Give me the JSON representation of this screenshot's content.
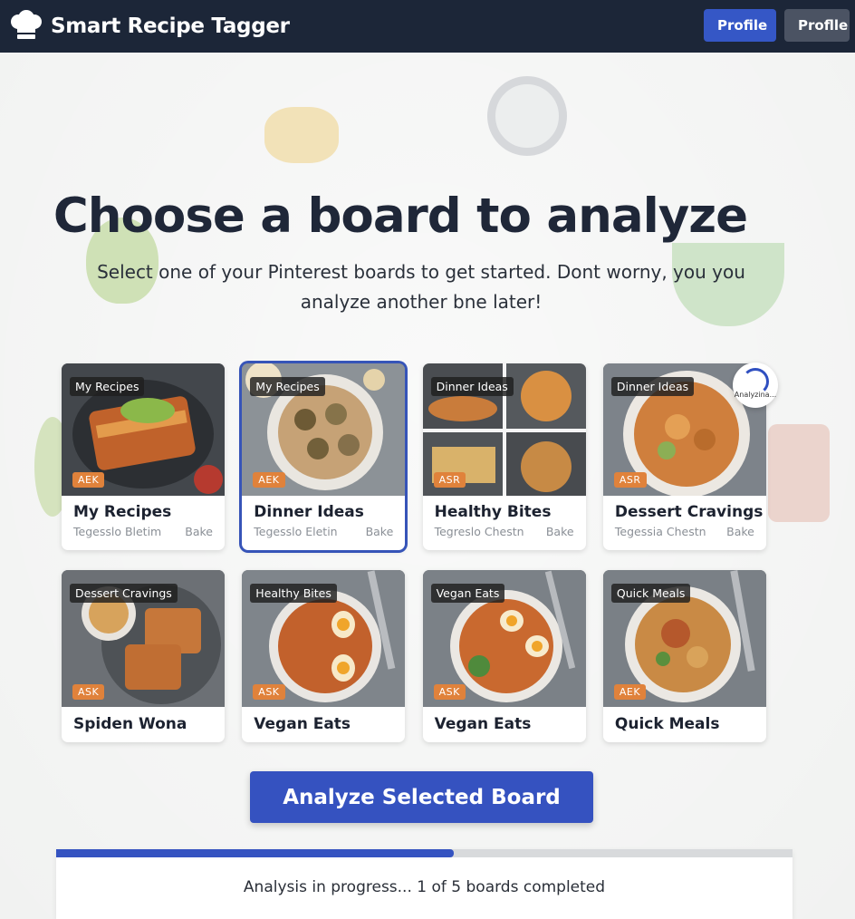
{
  "app": {
    "title": "Smart Recipe Tagger",
    "profile_button_primary": "Profile",
    "profile_button_secondary": "Proflle"
  },
  "page": {
    "headline": "Choose a board to analyze",
    "subline": "Select one of your Pinterest boards to get started. Dont worny, you you analyze another bne later!"
  },
  "boards": [
    {
      "tag": "My Recipes",
      "badge": "AEK",
      "title": "My Recipes",
      "meta": "Tegesslo Bletim",
      "category": "Bake",
      "selected": false
    },
    {
      "tag": "My Recipes",
      "badge": "AEK",
      "title": "Dinner Ideas",
      "meta": "Tegesslo Eletin",
      "category": "Bake",
      "selected": true
    },
    {
      "tag": "Dinner Ideas",
      "badge": "ASR",
      "title": "Healthy Bites",
      "meta": "Tegreslo Chestn",
      "category": "Bake",
      "selected": false
    },
    {
      "tag": "Dinner Ideas",
      "badge": "ASR",
      "title": "Dessert Cravings",
      "meta": "Tegessia Chestn",
      "category": "Bake",
      "selected": false
    },
    {
      "tag": "Dessert Cravings",
      "badge": "ASK",
      "title": "Spiden Wona",
      "meta": "",
      "category": "",
      "selected": false
    },
    {
      "tag": "Healthy Bites",
      "badge": "ASK",
      "title": "Vegan Eats",
      "meta": "",
      "category": "",
      "selected": false
    },
    {
      "tag": "Vegan Eats",
      "badge": "ASK",
      "title": "Vegan Eats",
      "meta": "",
      "category": "",
      "selected": false
    },
    {
      "tag": "Quick Meals",
      "badge": "AEK",
      "title": "Quick Meals",
      "meta": "",
      "category": "",
      "selected": false
    }
  ],
  "analyzing": {
    "label": "Analyzina..."
  },
  "actions": {
    "analyze_label": "Analyze Selected Board"
  },
  "progress": {
    "text": "Analysis in progress... 1 of 5 boards completed",
    "completed": 1,
    "total": 5,
    "fill_fraction": 0.54
  },
  "colors": {
    "header_bg": "#1c2638",
    "accent": "#3552c0",
    "badge": "#e0823b"
  },
  "icons": {
    "logo": "chef-hat-icon"
  }
}
